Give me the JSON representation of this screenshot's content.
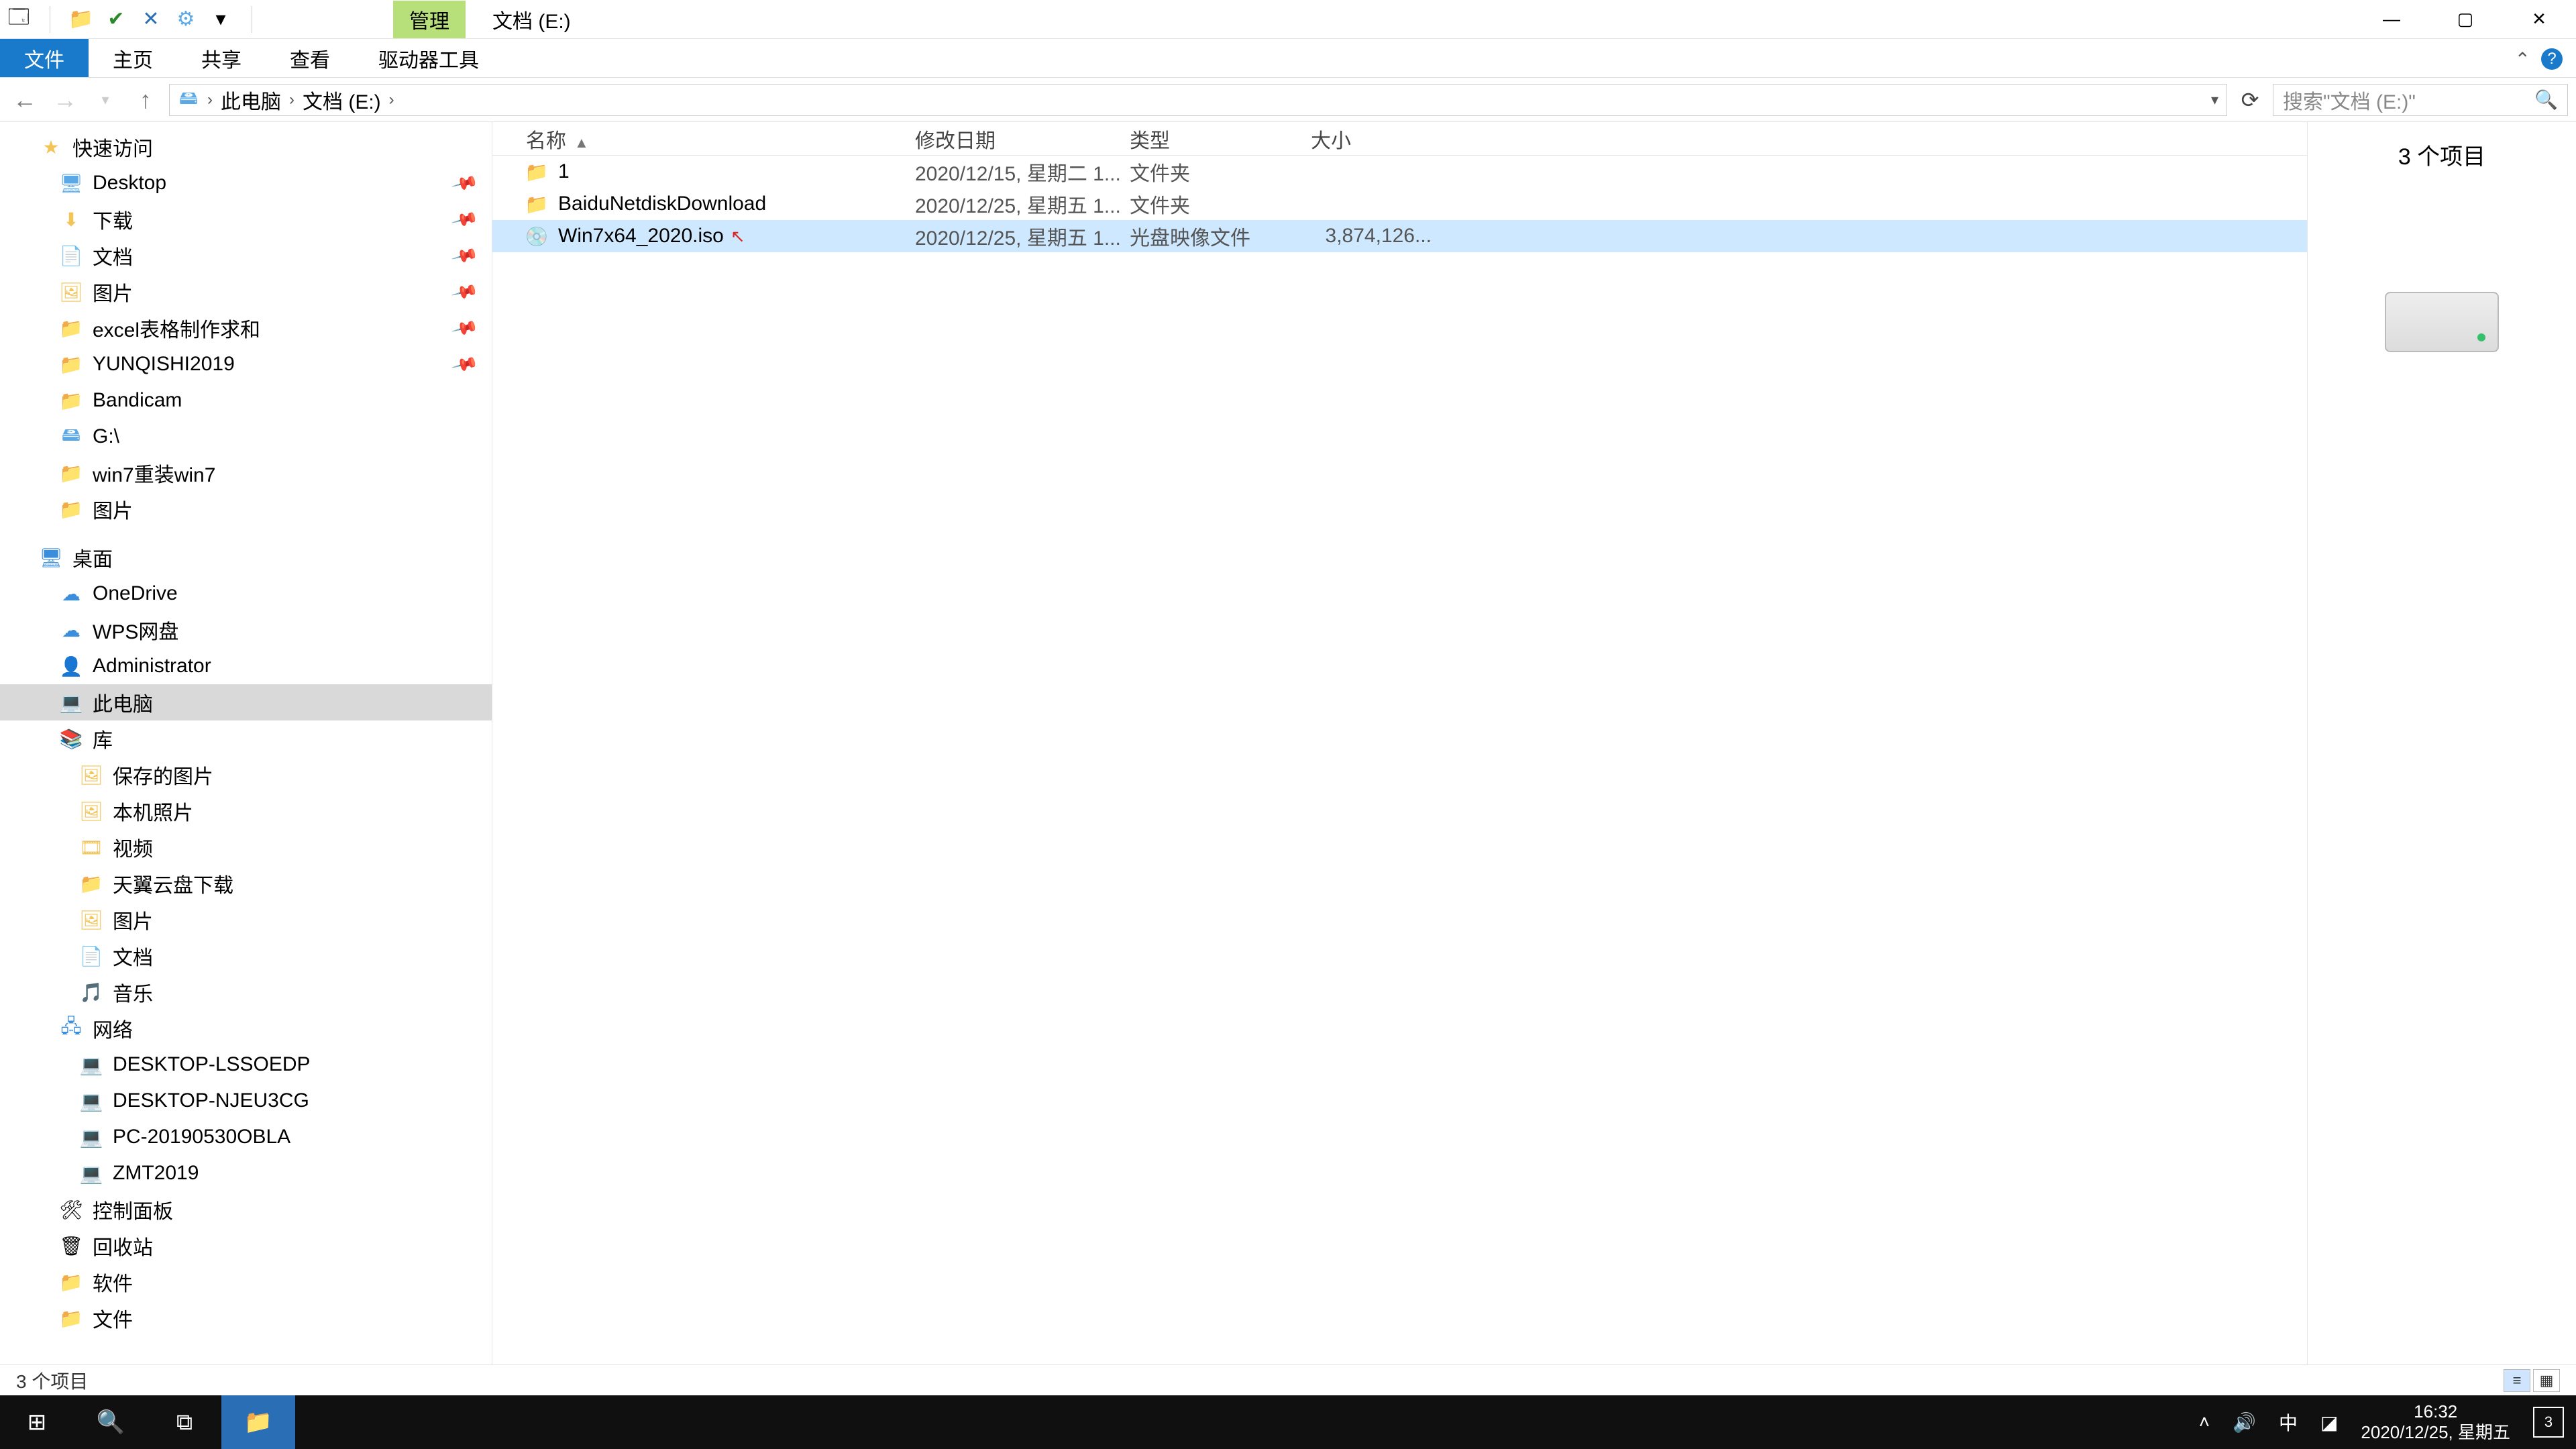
{
  "qat": {
    "down": "▾"
  },
  "titlebar": {
    "context_tab": "管理",
    "title": "文档 (E:)"
  },
  "ribbon": {
    "file": "文件",
    "home": "主页",
    "share": "共享",
    "view": "查看",
    "drive_tools": "驱动器工具"
  },
  "breadcrumb": {
    "pc": "此电脑",
    "drive": "文档 (E:)"
  },
  "search": {
    "placeholder": "搜索\"文档 (E:)\""
  },
  "nav": {
    "quick_access": "快速访问",
    "desktop": "Desktop",
    "downloads": "下载",
    "documents": "文档",
    "pictures": "图片",
    "excel": "excel表格制作求和",
    "yunqishi": "YUNQISHI2019",
    "bandicam": "Bandicam",
    "gdrive": "G:\\",
    "win7r": "win7重装win7",
    "pics2": "图片",
    "desktop_cn": "桌面",
    "onedrive": "OneDrive",
    "wps": "WPS网盘",
    "admin": "Administrator",
    "thispc": "此电脑",
    "libraries": "库",
    "savedpics": "保存的图片",
    "localpics": "本机照片",
    "videos": "视频",
    "tianyi": "天翼云盘下载",
    "pics3": "图片",
    "docs2": "文档",
    "music": "音乐",
    "network": "网络",
    "d1": "DESKTOP-LSSOEDP",
    "d2": "DESKTOP-NJEU3CG",
    "d3": "PC-20190530OBLA",
    "d4": "ZMT2019",
    "cpanel": "控制面板",
    "recycle": "回收站",
    "soft": "软件",
    "files": "文件"
  },
  "columns": {
    "name": "名称",
    "date": "修改日期",
    "type": "类型",
    "size": "大小"
  },
  "rows": [
    {
      "icon": "folder",
      "name": "1",
      "date": "2020/12/15, 星期二 1...",
      "type": "文件夹",
      "size": "",
      "sel": false
    },
    {
      "icon": "folder",
      "name": "BaiduNetdiskDownload",
      "date": "2020/12/25, 星期五 1...",
      "type": "文件夹",
      "size": "",
      "sel": false
    },
    {
      "icon": "iso",
      "name": "Win7x64_2020.iso",
      "date": "2020/12/25, 星期五 1...",
      "type": "光盘映像文件",
      "size": "3,874,126...",
      "sel": true
    }
  ],
  "preview": {
    "count": "3 个项目"
  },
  "status": {
    "text": "3 个项目"
  },
  "tray": {
    "ime": "中",
    "time": "16:32",
    "date": "2020/12/25, 星期五",
    "notif_count": "3"
  }
}
